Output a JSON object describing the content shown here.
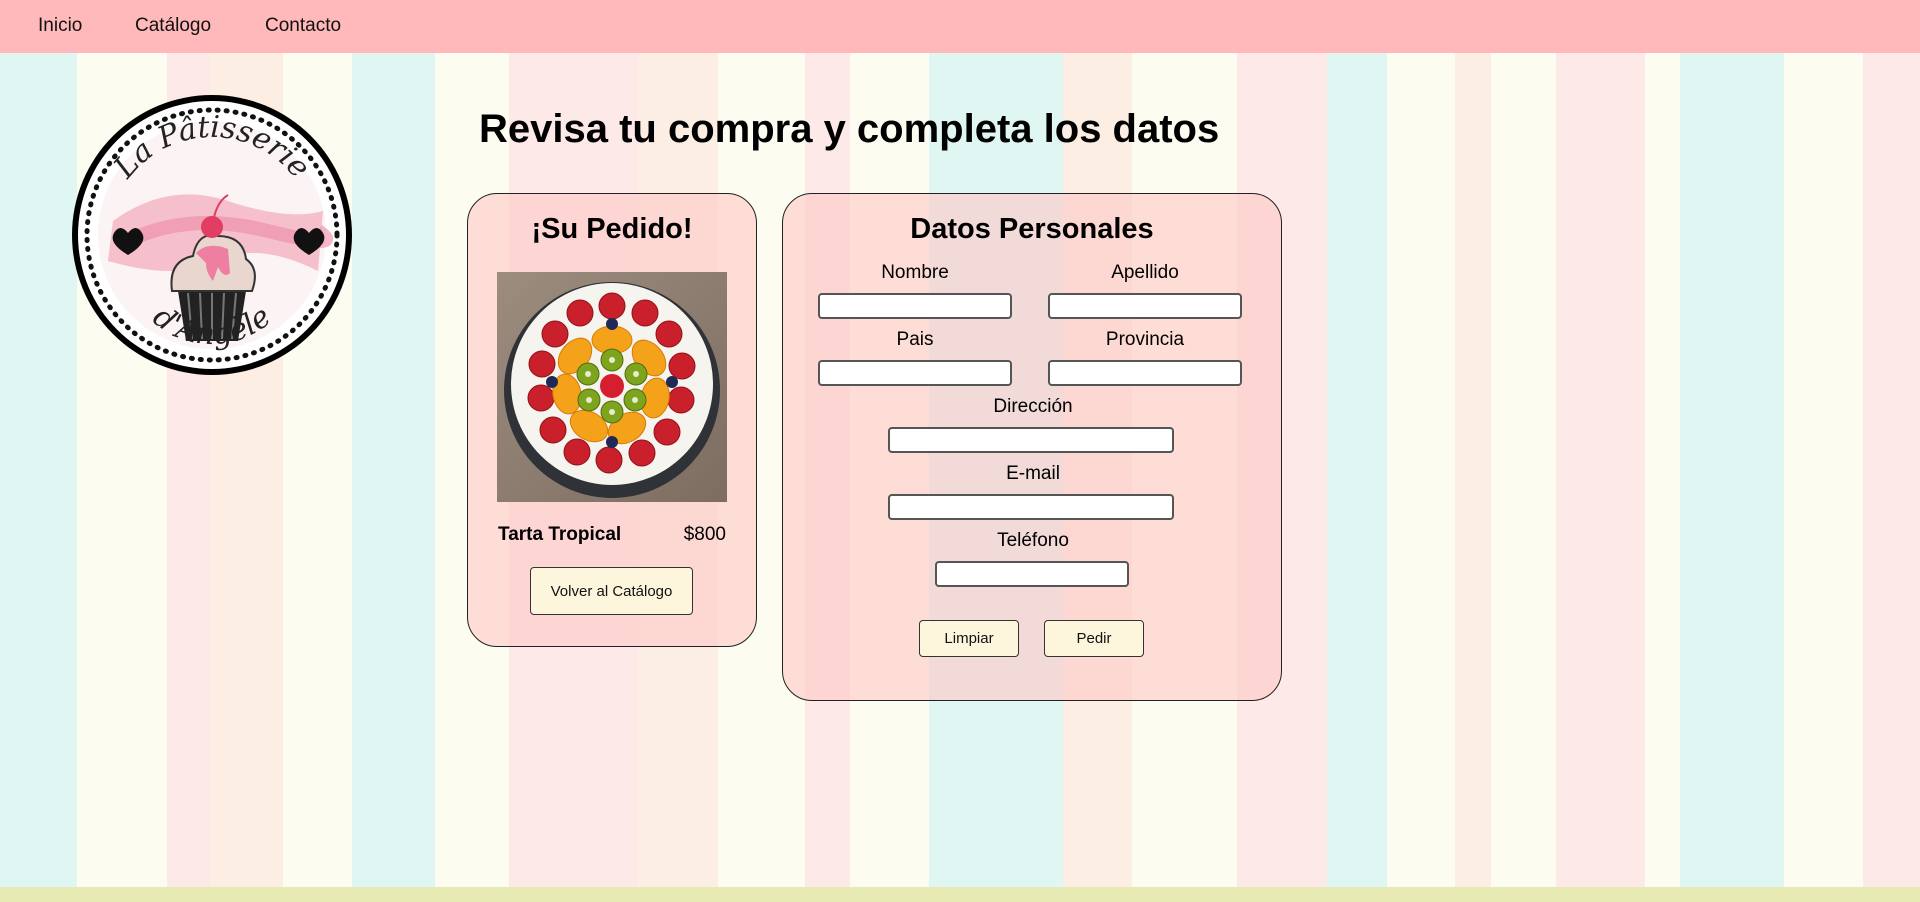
{
  "nav": {
    "items": [
      {
        "label": "Inicio"
      },
      {
        "label": "Catálogo"
      },
      {
        "label": "Contacto"
      }
    ]
  },
  "logo": {
    "line1": "La Pâtisserie",
    "line2": "d'Angèle"
  },
  "page": {
    "title": "Revisa tu compra y completa los datos"
  },
  "order": {
    "title": "¡Su Pedido!",
    "product_name": "Tarta Tropical",
    "product_price": "$800",
    "back_button": "Volver al Catálogo"
  },
  "personal": {
    "title": "Datos Personales",
    "fields": {
      "nombre": {
        "label": "Nombre",
        "value": ""
      },
      "apellido": {
        "label": "Apellido",
        "value": ""
      },
      "pais": {
        "label": "Pais",
        "value": ""
      },
      "provincia": {
        "label": "Provincia",
        "value": ""
      },
      "direccion": {
        "label": "Dirección",
        "value": ""
      },
      "email": {
        "label": "E-mail",
        "value": ""
      },
      "telefono": {
        "label": "Teléfono",
        "value": ""
      }
    },
    "clear_button": "Limpiar",
    "submit_button": "Pedir"
  },
  "colors": {
    "navbar": "#ffb9ba",
    "card_bg": "#fdc8c4",
    "button_bg": "#fef6dc",
    "footer": "#e7ebb3"
  }
}
